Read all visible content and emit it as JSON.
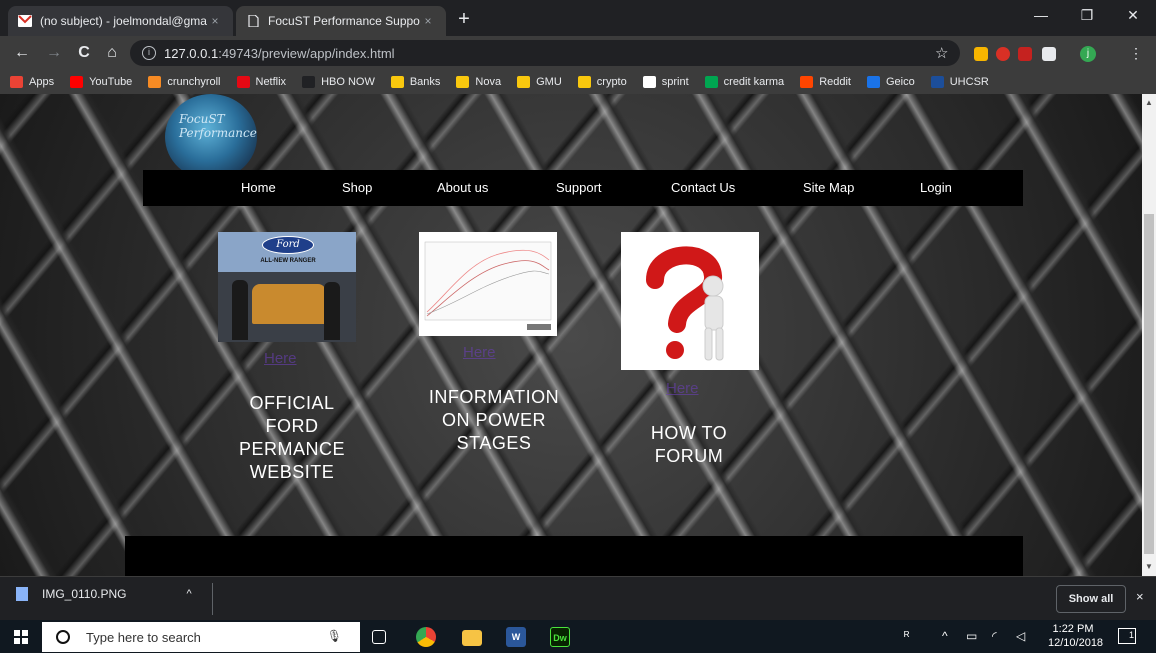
{
  "browser": {
    "tabs": [
      {
        "title": "(no subject) - joelmondal@gmail",
        "icon": "gmail-icon",
        "close": "×"
      },
      {
        "title": "FocuST Performance Support",
        "icon": "page-icon",
        "close": "×"
      }
    ],
    "new_tab": "+",
    "window_controls": {
      "minimize": "—",
      "restore": "❐",
      "close": "✕"
    },
    "nav": {
      "back": "←",
      "forward": "→",
      "reload": "C",
      "home": "⌂"
    },
    "address": {
      "host": "127.0.0.1",
      "rest": ":49743/preview/app/index.html",
      "info": "i"
    },
    "star": "☆",
    "profile_initial": "j",
    "menu": "⋮",
    "bookmarks": [
      {
        "label": "Apps",
        "color": "#ea4335"
      },
      {
        "label": "YouTube",
        "color": "#ff0000"
      },
      {
        "label": "crunchyroll",
        "color": "#f78b24"
      },
      {
        "label": "Netflix",
        "color": "#e50914"
      },
      {
        "label": "HBO NOW",
        "color": "#202124"
      },
      {
        "label": "Banks",
        "color": "#f9c80e"
      },
      {
        "label": "Nova",
        "color": "#f9c80e"
      },
      {
        "label": "GMU",
        "color": "#f9c80e"
      },
      {
        "label": "crypto",
        "color": "#f9c80e"
      },
      {
        "label": "sprint",
        "color": "#ffffff"
      },
      {
        "label": "credit karma",
        "color": "#00a651"
      },
      {
        "label": "Reddit",
        "color": "#ff4500"
      },
      {
        "label": "Geico",
        "color": "#1a73e8"
      },
      {
        "label": "UHCSR",
        "color": "#1c4e9a"
      }
    ]
  },
  "page": {
    "logo_text": "FocuST Performance",
    "nav": [
      "Home",
      "Shop",
      "About us",
      "Support",
      "Contact Us",
      "Site Map",
      "Login"
    ],
    "cards": [
      {
        "link": "Here",
        "text": [
          "OFFICIAL",
          "FORD",
          "PERMANCE",
          "WEBSITE"
        ],
        "image": "ford-ranger-photo"
      },
      {
        "link": "Here",
        "text": [
          "INFORMATION",
          "ON POWER",
          "STAGES"
        ],
        "image": "dyno-chart-photo"
      },
      {
        "link": "Here",
        "text": [
          "HOW TO",
          "FORUM"
        ],
        "image": "question-mark-figure"
      }
    ],
    "ford_badge": "Ford",
    "ranger_caption": "ALL-NEW RANGER"
  },
  "downloads": {
    "file": "IMG_0110.PNG",
    "chevron": "^",
    "show_all": "Show all",
    "close": "×"
  },
  "taskbar": {
    "search_placeholder": "Type here to search",
    "apps": [
      "task-view",
      "chrome",
      "file-explorer",
      "word",
      "dreamweaver"
    ],
    "word_label": "W",
    "dw_label": "Dw",
    "time": "1:22 PM",
    "date": "12/10/2018",
    "notifications": "1"
  }
}
